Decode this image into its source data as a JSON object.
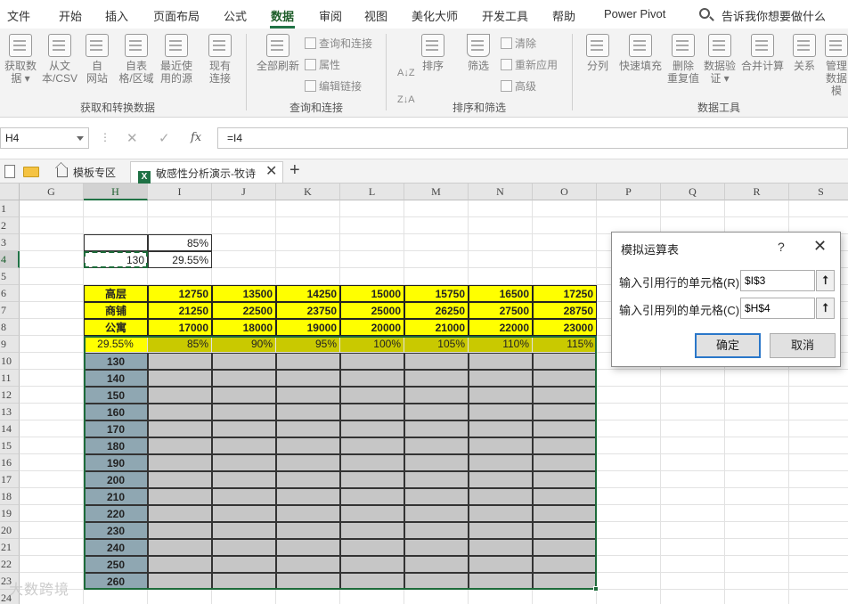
{
  "menu": [
    "文件",
    "开始",
    "插入",
    "页面布局",
    "公式",
    "数据",
    "审阅",
    "视图",
    "美化大师",
    "开发工具",
    "帮助",
    "Power Pivot"
  ],
  "menu_active_index": 5,
  "tell_me": "告诉我你想要做什么",
  "ribbon": {
    "get_data": [
      "获取数\n据 ▾",
      "从文\n本/CSV",
      "自\n网站",
      "自表\n格/区域",
      "最近使\n用的源",
      "现有\n连接"
    ],
    "refresh": "全部刷新",
    "query_small": [
      "查询和连接",
      "属性",
      "编辑链接"
    ],
    "sort_asc": "A↓Z",
    "sort_desc": "Z↓A",
    "sort": "排序",
    "filter": "筛选",
    "filter_small": [
      "清除",
      "重新应用",
      "高级"
    ],
    "tools": [
      "分列",
      "快速填充",
      "删除\n重复值",
      "数据验\n证 ▾",
      "合并计算",
      "关系",
      "管理\n数据模"
    ],
    "groups": [
      "获取和转换数据",
      "查询和连接",
      "排序和筛选",
      "数据工具"
    ]
  },
  "formula_bar": {
    "name_box": "H4",
    "formula": "=I4"
  },
  "tabs": {
    "home": "模板专区",
    "file": "敏感性分析演示-牧诗"
  },
  "columns": [
    "G",
    "H",
    "I",
    "J",
    "K",
    "L",
    "M",
    "N",
    "O",
    "P",
    "Q",
    "R",
    "S"
  ],
  "rows": [
    "1",
    "2",
    "3",
    "4",
    "5",
    "6",
    "7",
    "8",
    "9",
    "10",
    "11",
    "12",
    "13",
    "14",
    "15",
    "16",
    "17",
    "18",
    "19",
    "20",
    "21",
    "22",
    "23",
    "24"
  ],
  "cells": {
    "I3": "85%",
    "H4": "130",
    "I4": "29.55%",
    "categories": [
      {
        "label": "高层",
        "values": [
          "12750",
          "13500",
          "14250",
          "15000",
          "15750",
          "16500",
          "17250"
        ]
      },
      {
        "label": "商铺",
        "values": [
          "21250",
          "22500",
          "23750",
          "25000",
          "26250",
          "27500",
          "28750"
        ]
      },
      {
        "label": "公寓",
        "values": [
          "17000",
          "18000",
          "19000",
          "20000",
          "21000",
          "22000",
          "23000"
        ]
      }
    ],
    "H9": "29.55%",
    "pct_row": [
      "85%",
      "90%",
      "95%",
      "100%",
      "105%",
      "110%",
      "115%"
    ],
    "h_values": [
      "130",
      "140",
      "150",
      "160",
      "170",
      "180",
      "190",
      "200",
      "210",
      "220",
      "230",
      "240",
      "250",
      "260"
    ]
  },
  "dialog": {
    "title": "模拟运算表",
    "help": "?",
    "row_label": "输入引用行的单元格(R):",
    "row_value": "$I$3",
    "col_label": "输入引用列的单元格(C):",
    "col_value": "$H$4",
    "ok": "确定",
    "cancel": "取消"
  },
  "watermark": "大数跨境"
}
